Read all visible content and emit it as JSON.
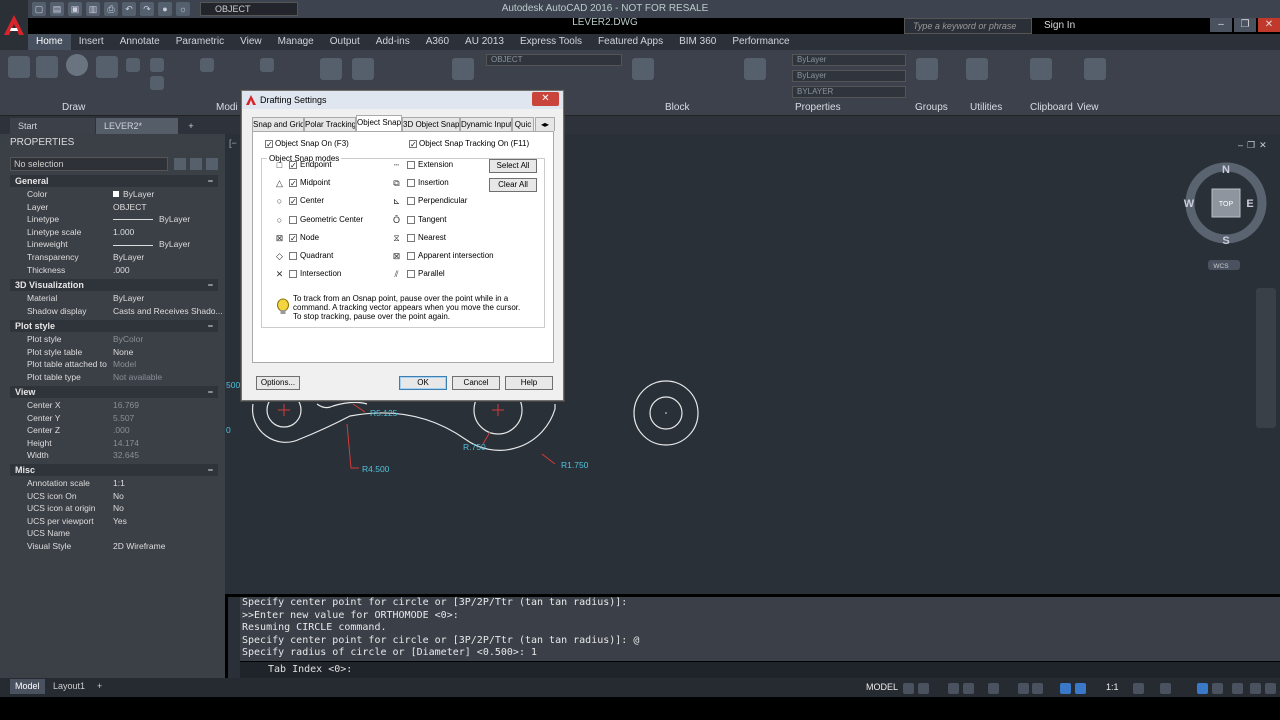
{
  "title_bar": {
    "window_title": "Autodesk AutoCAD 2016 - NOT FOR RESALE    LEVER2.DWG",
    "layer_combo": "OBJECT",
    "search_placeholder": "Type a keyword or phrase",
    "sign_in": "Sign In"
  },
  "ribbon": {
    "tabs": [
      "Home",
      "Insert",
      "Annotate",
      "Parametric",
      "View",
      "Manage",
      "Output",
      "Add-ins",
      "A360",
      "AU 2013",
      "Express Tools",
      "Featured Apps",
      "BIM 360",
      "Performance"
    ],
    "active_tab": "Home",
    "panels": {
      "draw": "Draw",
      "modify": "Modi",
      "block": "Block",
      "properties": "Properties",
      "groups": "Groups",
      "utilities": "Utilities",
      "clipboard": "Clipboard",
      "view": "View"
    },
    "combos": {
      "layer": "OBJECT",
      "color": "ByLayer",
      "linetype": "ByLayer",
      "lineweight": "BYLAYER"
    }
  },
  "file_tabs": {
    "start": "Start",
    "lever": "LEVER2*",
    "plus": "+"
  },
  "properties": {
    "title": "PROPERTIES",
    "selection": "No selection",
    "sections": {
      "general": "General",
      "viz": "3D Visualization",
      "plot": "Plot style",
      "view": "View",
      "misc": "Misc"
    },
    "general": [
      {
        "k": "Color",
        "v": "ByLayer"
      },
      {
        "k": "Layer",
        "v": "OBJECT"
      },
      {
        "k": "Linetype",
        "v": "ByLayer"
      },
      {
        "k": "Linetype scale",
        "v": "1.000"
      },
      {
        "k": "Lineweight",
        "v": "ByLayer"
      },
      {
        "k": "Transparency",
        "v": "ByLayer"
      },
      {
        "k": "Thickness",
        "v": ".000"
      }
    ],
    "viz": [
      {
        "k": "Material",
        "v": "ByLayer"
      },
      {
        "k": "Shadow display",
        "v": "Casts and Receives Shado..."
      }
    ],
    "plot": [
      {
        "k": "Plot style",
        "v": "ByColor"
      },
      {
        "k": "Plot style table",
        "v": "None"
      },
      {
        "k": "Plot table attached to",
        "v": "Model"
      },
      {
        "k": "Plot table type",
        "v": "Not available"
      }
    ],
    "view": [
      {
        "k": "Center X",
        "v": "16.769"
      },
      {
        "k": "Center Y",
        "v": "5.507"
      },
      {
        "k": "Center Z",
        "v": ".000"
      },
      {
        "k": "Height",
        "v": "14.174"
      },
      {
        "k": "Width",
        "v": "32.645"
      }
    ],
    "misc": [
      {
        "k": "Annotation scale",
        "v": "1:1"
      },
      {
        "k": "UCS icon On",
        "v": "No"
      },
      {
        "k": "UCS icon at origin",
        "v": "No"
      },
      {
        "k": "UCS per viewport",
        "v": "Yes"
      },
      {
        "k": "UCS Name",
        "v": ""
      },
      {
        "k": "Visual Style",
        "v": "2D Wireframe"
      }
    ]
  },
  "viewcube": {
    "n": "N",
    "s": "S",
    "e": "E",
    "w": "W",
    "top": "TOP",
    "ucs": "WCS"
  },
  "drawing_labels": {
    "r5125": "R5.125",
    "r750": "R.750",
    "r4500": "R4.500",
    "r1750": "R1.750",
    "left1": "500",
    "left2": "0"
  },
  "dialog": {
    "title": "Drafting Settings",
    "tabs": [
      "Snap and Grid",
      "Polar Tracking",
      "Object Snap",
      "3D Object Snap",
      "Dynamic Input",
      "Quic"
    ],
    "active_tab": "Object Snap",
    "osnap_on": "Object Snap On (F3)",
    "tracking_on": "Object Snap Tracking On (F11)",
    "modes_title": "Object Snap modes",
    "left_modes": [
      {
        "label": "Endpoint",
        "checked": true,
        "sym": "□"
      },
      {
        "label": "Midpoint",
        "checked": true,
        "sym": "△"
      },
      {
        "label": "Center",
        "checked": true,
        "sym": "○"
      },
      {
        "label": "Geometric Center",
        "checked": false,
        "sym": "○"
      },
      {
        "label": "Node",
        "checked": true,
        "sym": "⊠"
      },
      {
        "label": "Quadrant",
        "checked": false,
        "sym": "◇"
      },
      {
        "label": "Intersection",
        "checked": false,
        "sym": "✕"
      }
    ],
    "right_modes": [
      {
        "label": "Extension",
        "checked": false,
        "sym": "┄"
      },
      {
        "label": "Insertion",
        "checked": false,
        "sym": "⧉"
      },
      {
        "label": "Perpendicular",
        "checked": false,
        "sym": "⊾"
      },
      {
        "label": "Tangent",
        "checked": false,
        "sym": "Ō"
      },
      {
        "label": "Nearest",
        "checked": false,
        "sym": "⧖"
      },
      {
        "label": "Apparent intersection",
        "checked": false,
        "sym": "⊠"
      },
      {
        "label": "Parallel",
        "checked": false,
        "sym": "⫽"
      }
    ],
    "select_all": "Select All",
    "clear_all": "Clear All",
    "hint_lines": [
      "To track from an Osnap point, pause over the point while in a",
      "command.  A tracking vector appears when you move the cursor.",
      "To stop tracking, pause over the point again."
    ],
    "options": "Options...",
    "ok": "OK",
    "cancel": "Cancel",
    "help": "Help"
  },
  "command": {
    "history": [
      "Specify center point for circle or [3P/2P/Ttr (tan tan radius)]:",
      ">>Enter new value for ORTHOMODE <0>:",
      "Resuming CIRCLE command.",
      "Specify center point for circle or [3P/2P/Ttr (tan tan radius)]: @",
      "Specify radius of circle or [Diameter] <0.500>: 1"
    ],
    "prompt": "Tab Index <0>:"
  },
  "status": {
    "model_tab": "Model",
    "layout1_tab": "Layout1",
    "plus": "+",
    "model": "MODEL",
    "scale": "1:1"
  },
  "colors": {
    "accent_blue": "#3a78c8",
    "drawing_white": "#e8e8e8",
    "dimension_cyan": "#4fc3dd",
    "dimension_red": "#d23b3b"
  }
}
